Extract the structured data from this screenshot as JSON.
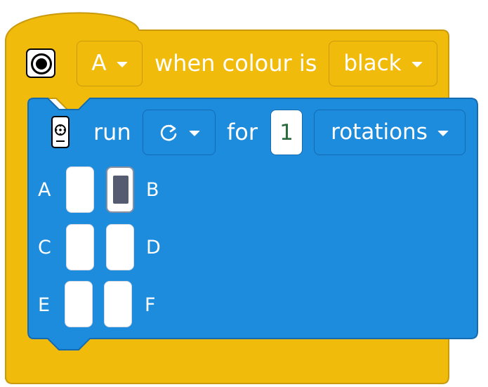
{
  "hat_block": {
    "port_dropdown": "A",
    "condition_text": "when colour is",
    "colour_dropdown": "black",
    "color": "#f1bb0b",
    "border_color": "#c99a0c"
  },
  "motor_block": {
    "run_label": "run",
    "direction_icon": "clockwise-icon",
    "for_label": "for",
    "amount": "1",
    "unit_dropdown": "rotations",
    "color": "#1e8cdd",
    "border_color": "#146bb1",
    "ports": [
      {
        "label": "A",
        "selected": false
      },
      {
        "label": "B",
        "selected": true
      },
      {
        "label": "C",
        "selected": false
      },
      {
        "label": "D",
        "selected": false
      },
      {
        "label": "E",
        "selected": false
      },
      {
        "label": "F",
        "selected": false
      }
    ]
  }
}
